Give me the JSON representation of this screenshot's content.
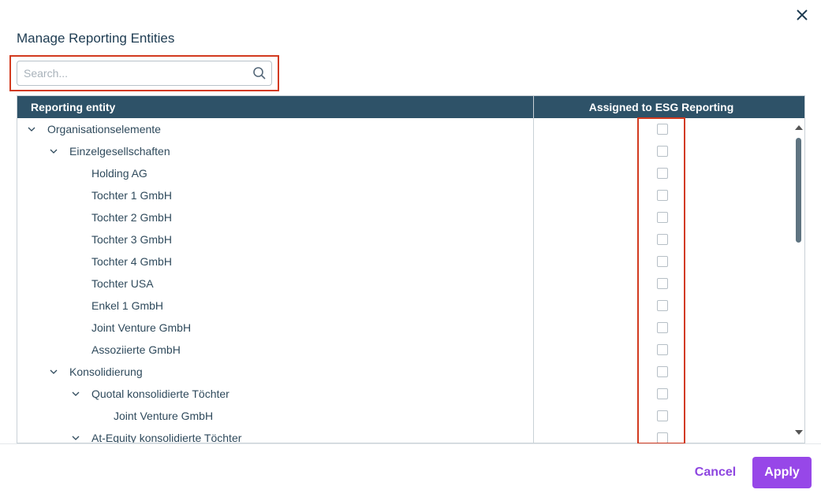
{
  "dialog": {
    "title": "Manage Reporting Entities",
    "close_icon": "close-icon"
  },
  "search": {
    "placeholder": "Search...",
    "value": "",
    "icon": "search-icon"
  },
  "table": {
    "columns": [
      "Reporting entity",
      "Assigned to ESG Reporting"
    ],
    "rows": [
      {
        "label": "Organisationselemente",
        "level": 0,
        "expandable": true,
        "expanded": true,
        "checked": false
      },
      {
        "label": "Einzelgesellschaften",
        "level": 1,
        "expandable": true,
        "expanded": true,
        "checked": false
      },
      {
        "label": "Holding AG",
        "level": 2,
        "expandable": false,
        "checked": false
      },
      {
        "label": "Tochter 1 GmbH",
        "level": 2,
        "expandable": false,
        "checked": false
      },
      {
        "label": "Tochter 2 GmbH",
        "level": 2,
        "expandable": false,
        "checked": false
      },
      {
        "label": "Tochter 3 GmbH",
        "level": 2,
        "expandable": false,
        "checked": false
      },
      {
        "label": "Tochter 4 GmbH",
        "level": 2,
        "expandable": false,
        "checked": false
      },
      {
        "label": "Tochter USA",
        "level": 2,
        "expandable": false,
        "checked": false
      },
      {
        "label": "Enkel 1 GmbH",
        "level": 2,
        "expandable": false,
        "checked": false
      },
      {
        "label": "Joint Venture GmbH",
        "level": 2,
        "expandable": false,
        "checked": false
      },
      {
        "label": "Assoziierte GmbH",
        "level": 2,
        "expandable": false,
        "checked": false
      },
      {
        "label": "Konsolidierung",
        "level": 1,
        "expandable": true,
        "expanded": true,
        "checked": false
      },
      {
        "label": "Quotal konsolidierte Töchter",
        "level": 2,
        "expandable": true,
        "expanded": true,
        "checked": false
      },
      {
        "label": "Joint Venture GmbH",
        "level": 3,
        "expandable": false,
        "checked": false
      },
      {
        "label": "At-Equity konsolidierte Töchter",
        "level": 2,
        "expandable": true,
        "expanded": true,
        "checked": false
      }
    ]
  },
  "footer": {
    "cancel_label": "Cancel",
    "apply_label": "Apply"
  },
  "colors": {
    "header_bg": "#2e5268",
    "accent": "#9747e8",
    "highlight": "#d23a1f"
  }
}
